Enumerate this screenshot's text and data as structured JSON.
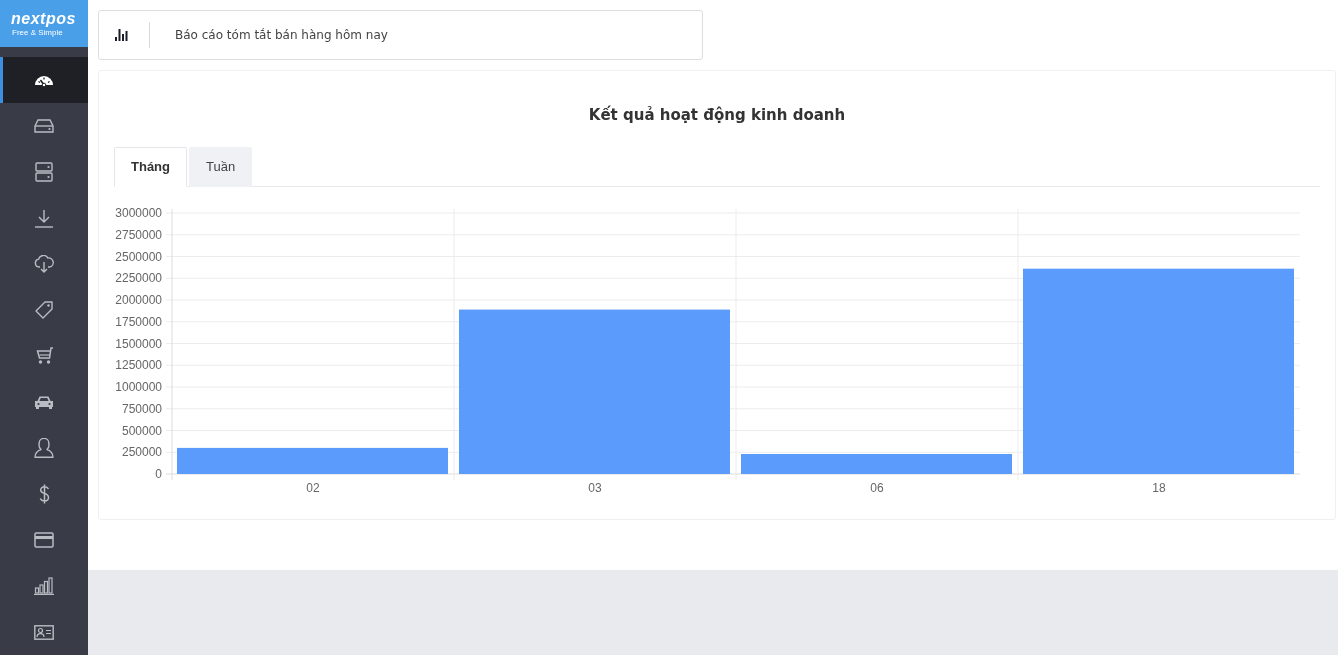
{
  "logo": {
    "text": "nextpos",
    "tagline": "Free & Simple"
  },
  "sidebar": {
    "items": [
      {
        "selected": true
      },
      {
        "selected": false
      },
      {
        "selected": false
      },
      {
        "selected": false
      },
      {
        "selected": false
      },
      {
        "selected": false
      },
      {
        "selected": false
      },
      {
        "selected": false
      },
      {
        "selected": false
      },
      {
        "selected": false
      },
      {
        "selected": false
      },
      {
        "selected": false
      },
      {
        "selected": false
      }
    ]
  },
  "report_header": {
    "label": "Báo cáo tóm tắt bán hàng hôm nay"
  },
  "card": {
    "title": "Kết quả hoạt động kinh doanh",
    "tabs": [
      {
        "label": "Tháng",
        "selected": true
      },
      {
        "label": "Tuần",
        "selected": false
      }
    ],
    "chart_data": {
      "type": "bar",
      "grid": true,
      "categories": [
        "02",
        "03",
        "06",
        "18"
      ],
      "values": [
        300000,
        1890000,
        230000,
        2360000
      ],
      "ylim": [
        0,
        3000000
      ],
      "yticks": [
        0,
        250000,
        500000,
        750000,
        1000000,
        1250000,
        1500000,
        1750000,
        2000000,
        2250000,
        2500000,
        2750000,
        3000000
      ]
    }
  }
}
